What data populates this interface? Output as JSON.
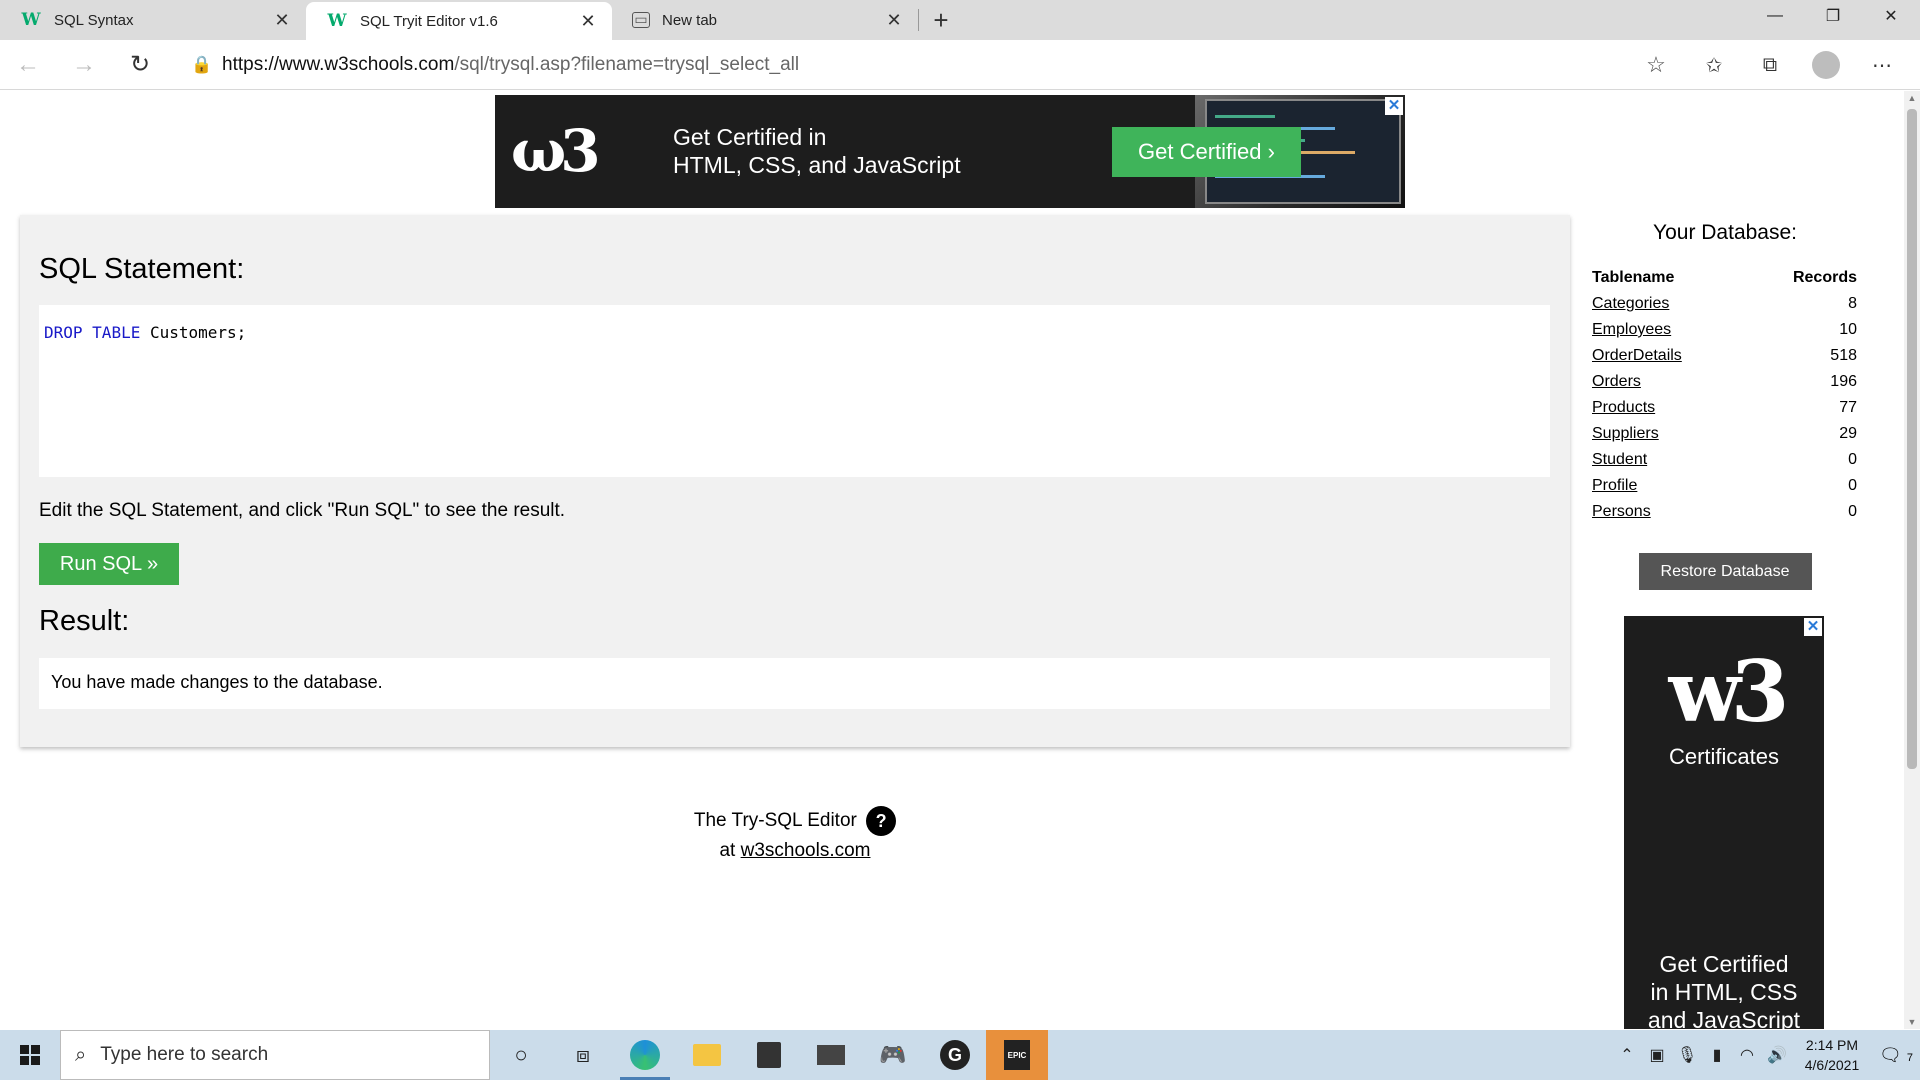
{
  "browser": {
    "tabs": [
      {
        "title": "SQL Syntax",
        "favicon": "w3schools-icon",
        "active": false
      },
      {
        "title": "SQL Tryit Editor v1.6",
        "favicon": "w3schools-icon",
        "active": true
      },
      {
        "title": "New tab",
        "favicon": "newtab-icon",
        "active": false
      }
    ],
    "url_domain": "https://www.w3schools.com",
    "url_path": "/sql/trysql.asp?filename=trysql_select_all"
  },
  "ad_top": {
    "line1": "Get Certified in",
    "line2": "HTML, CSS, and JavaScript",
    "cta": "Get Certified ›",
    "close": "✕"
  },
  "editor": {
    "heading": "SQL Statement:",
    "code_kw1": "DROP",
    "code_kw2": "TABLE",
    "code_rest": " Customers;",
    "instruction": "Edit the SQL Statement, and click \"Run SQL\" to see the result.",
    "run_label": "Run SQL »",
    "result_heading": "Result:",
    "result_text": "You have made changes to the database."
  },
  "footer": {
    "line1": "The Try-SQL Editor",
    "help": "?",
    "at": "at ",
    "link": "w3schools.com"
  },
  "database": {
    "heading": "Your Database:",
    "col_name": "Tablename",
    "col_records": "Records",
    "rows": [
      {
        "name": "Categories",
        "records": "8"
      },
      {
        "name": "Employees",
        "records": "10"
      },
      {
        "name": "OrderDetails",
        "records": "518"
      },
      {
        "name": "Orders",
        "records": "196"
      },
      {
        "name": "Products",
        "records": "77"
      },
      {
        "name": "Suppliers",
        "records": "29"
      },
      {
        "name": "Student",
        "records": "0"
      },
      {
        "name": "Profile",
        "records": "0"
      },
      {
        "name": "Persons",
        "records": "0"
      }
    ],
    "restore_label": "Restore Database"
  },
  "ad_side": {
    "brand": "w3",
    "certificates": "Certificates",
    "line1": "Get Certified",
    "line2": "in HTML, CSS",
    "line3": "and JavaScript"
  },
  "taskbar": {
    "search_placeholder": "Type here to search",
    "time": "2:14 PM",
    "date": "4/6/2021",
    "notifications": "7"
  },
  "colors": {
    "run_button": "#3eab4b",
    "keyword": "#1919c8",
    "w3_green": "#04aa6d"
  }
}
